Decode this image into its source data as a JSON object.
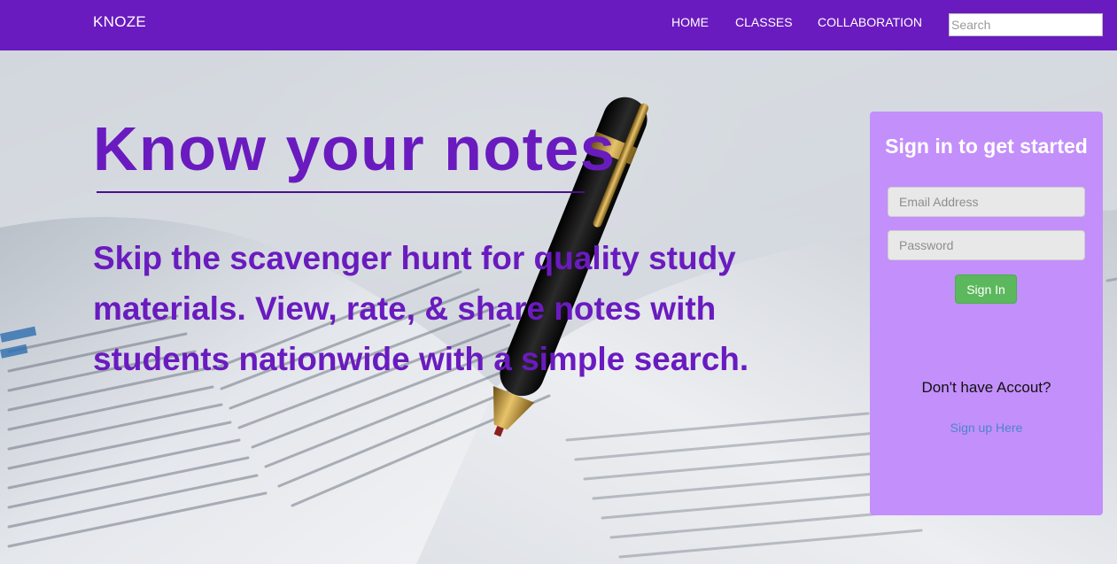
{
  "navbar": {
    "brand": "KNOZE",
    "links": [
      {
        "label": "HOME"
      },
      {
        "label": "CLASSES"
      },
      {
        "label": "COLLABORATION"
      }
    ],
    "search": {
      "placeholder": "Search",
      "value": ""
    }
  },
  "hero": {
    "headline": "Know your notes",
    "tagline": "Skip the scavenger hunt for quality study materials. View, rate, & share notes with students nationwide with a simple search."
  },
  "signin": {
    "title": "Sign in to get started",
    "email": {
      "placeholder": "Email Address",
      "value": ""
    },
    "password": {
      "placeholder": "Password",
      "value": ""
    },
    "button_label": "Sign In",
    "no_account_text": "Don't have Accout?",
    "signup_link": "Sign up Here"
  },
  "colors": {
    "brand_purple": "#6a1bbf",
    "panel_lilac": "#c38ffb",
    "button_green": "#5cb85c",
    "link_blue": "#4a86c9"
  }
}
